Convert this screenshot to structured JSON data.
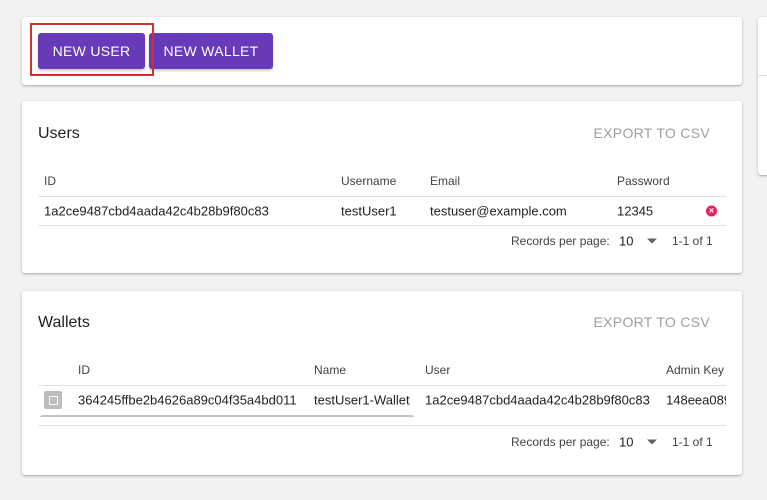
{
  "toolbar": {
    "new_user_label": "NEW USER",
    "new_wallet_label": "NEW WALLET"
  },
  "users": {
    "title": "Users",
    "export_label": "EXPORT TO CSV",
    "columns": [
      "ID",
      "Username",
      "Email",
      "Password"
    ],
    "rows": [
      {
        "id": "1a2ce9487cbd4aada42c4b28b9f80c83",
        "username": "testUser1",
        "email": "testuser@example.com",
        "password": "12345"
      }
    ],
    "footer": {
      "records_label": "Records per page:",
      "per_page": "10",
      "range": "1-1 of 1"
    }
  },
  "wallets": {
    "title": "Wallets",
    "export_label": "EXPORT TO CSV",
    "columns": [
      "ID",
      "Name",
      "User",
      "Admin Key"
    ],
    "rows": [
      {
        "id": "364245ffbe2b4626a89c04f35a4bd011",
        "name": "testUser1-Wallet",
        "user": "1a2ce9487cbd4aada42c4b28b9f80c83",
        "admin_key": "148eea089"
      }
    ],
    "footer": {
      "records_label": "Records per page:",
      "per_page": "10",
      "range": "1-1 of 1"
    }
  },
  "colors": {
    "primary": "#673ab7",
    "highlight": "#d32f2f",
    "delete": "#e91e63"
  }
}
